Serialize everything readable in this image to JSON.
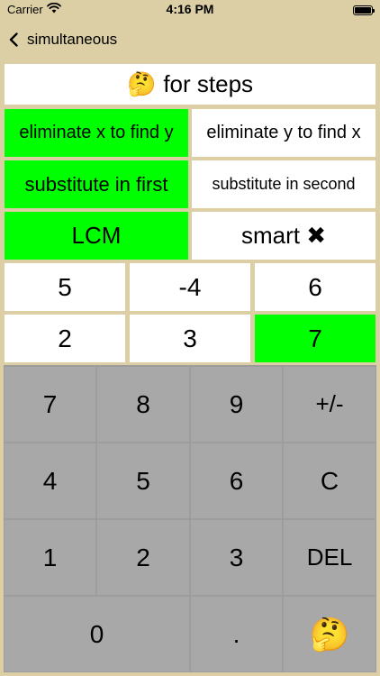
{
  "status": {
    "carrier": "Carrier",
    "time": "4:16 PM"
  },
  "nav": {
    "back_label": "simultaneous"
  },
  "steps": {
    "emoji": "🤔",
    "label": "for steps"
  },
  "options": {
    "eliminate_x": "eliminate x to find y",
    "eliminate_y": "eliminate y to find x",
    "sub_first": "substitute in first",
    "sub_second": "substitute in second",
    "lcm": "LCM",
    "smart": "smart ✖"
  },
  "equations": {
    "row1": [
      "5",
      "-4",
      "6"
    ],
    "row2": [
      "2",
      "3",
      "7"
    ]
  },
  "keypad": {
    "row1": [
      "7",
      "8",
      "9",
      "+/-"
    ],
    "row2": [
      "4",
      "5",
      "6",
      "C"
    ],
    "row3": [
      "1",
      "2",
      "3",
      "DEL"
    ],
    "zero": "0",
    "dot": ".",
    "think_emoji": "🤔"
  },
  "colors": {
    "background": "#dccfa6",
    "selected": "#00ff00",
    "key": "#a8a8a8"
  }
}
